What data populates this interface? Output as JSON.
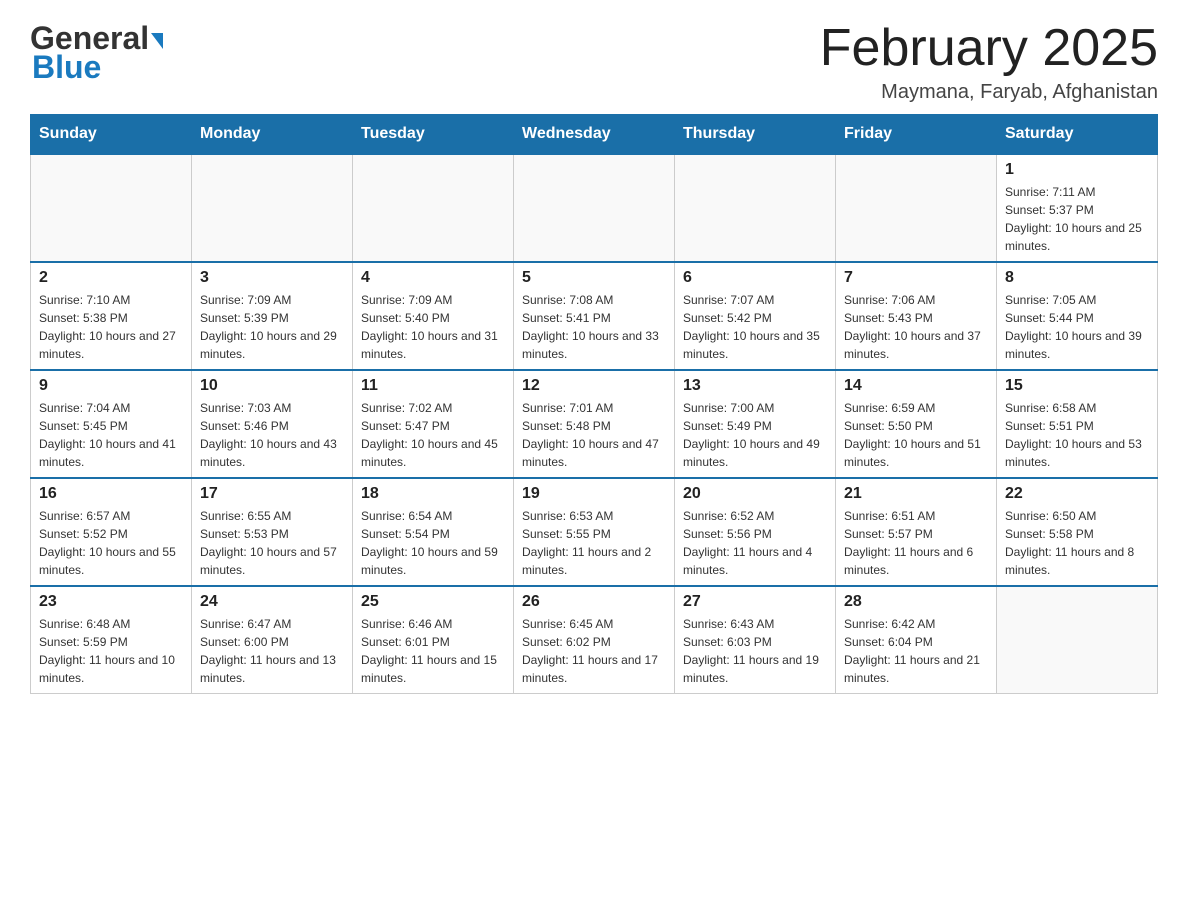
{
  "header": {
    "logo_main": "General",
    "logo_blue": "Blue",
    "month_title": "February 2025",
    "location": "Maymana, Faryab, Afghanistan"
  },
  "weekdays": [
    "Sunday",
    "Monday",
    "Tuesday",
    "Wednesday",
    "Thursday",
    "Friday",
    "Saturday"
  ],
  "weeks": [
    {
      "days": [
        {
          "num": "",
          "info": ""
        },
        {
          "num": "",
          "info": ""
        },
        {
          "num": "",
          "info": ""
        },
        {
          "num": "",
          "info": ""
        },
        {
          "num": "",
          "info": ""
        },
        {
          "num": "",
          "info": ""
        },
        {
          "num": "1",
          "info": "Sunrise: 7:11 AM\nSunset: 5:37 PM\nDaylight: 10 hours and 25 minutes."
        }
      ]
    },
    {
      "days": [
        {
          "num": "2",
          "info": "Sunrise: 7:10 AM\nSunset: 5:38 PM\nDaylight: 10 hours and 27 minutes."
        },
        {
          "num": "3",
          "info": "Sunrise: 7:09 AM\nSunset: 5:39 PM\nDaylight: 10 hours and 29 minutes."
        },
        {
          "num": "4",
          "info": "Sunrise: 7:09 AM\nSunset: 5:40 PM\nDaylight: 10 hours and 31 minutes."
        },
        {
          "num": "5",
          "info": "Sunrise: 7:08 AM\nSunset: 5:41 PM\nDaylight: 10 hours and 33 minutes."
        },
        {
          "num": "6",
          "info": "Sunrise: 7:07 AM\nSunset: 5:42 PM\nDaylight: 10 hours and 35 minutes."
        },
        {
          "num": "7",
          "info": "Sunrise: 7:06 AM\nSunset: 5:43 PM\nDaylight: 10 hours and 37 minutes."
        },
        {
          "num": "8",
          "info": "Sunrise: 7:05 AM\nSunset: 5:44 PM\nDaylight: 10 hours and 39 minutes."
        }
      ]
    },
    {
      "days": [
        {
          "num": "9",
          "info": "Sunrise: 7:04 AM\nSunset: 5:45 PM\nDaylight: 10 hours and 41 minutes."
        },
        {
          "num": "10",
          "info": "Sunrise: 7:03 AM\nSunset: 5:46 PM\nDaylight: 10 hours and 43 minutes."
        },
        {
          "num": "11",
          "info": "Sunrise: 7:02 AM\nSunset: 5:47 PM\nDaylight: 10 hours and 45 minutes."
        },
        {
          "num": "12",
          "info": "Sunrise: 7:01 AM\nSunset: 5:48 PM\nDaylight: 10 hours and 47 minutes."
        },
        {
          "num": "13",
          "info": "Sunrise: 7:00 AM\nSunset: 5:49 PM\nDaylight: 10 hours and 49 minutes."
        },
        {
          "num": "14",
          "info": "Sunrise: 6:59 AM\nSunset: 5:50 PM\nDaylight: 10 hours and 51 minutes."
        },
        {
          "num": "15",
          "info": "Sunrise: 6:58 AM\nSunset: 5:51 PM\nDaylight: 10 hours and 53 minutes."
        }
      ]
    },
    {
      "days": [
        {
          "num": "16",
          "info": "Sunrise: 6:57 AM\nSunset: 5:52 PM\nDaylight: 10 hours and 55 minutes."
        },
        {
          "num": "17",
          "info": "Sunrise: 6:55 AM\nSunset: 5:53 PM\nDaylight: 10 hours and 57 minutes."
        },
        {
          "num": "18",
          "info": "Sunrise: 6:54 AM\nSunset: 5:54 PM\nDaylight: 10 hours and 59 minutes."
        },
        {
          "num": "19",
          "info": "Sunrise: 6:53 AM\nSunset: 5:55 PM\nDaylight: 11 hours and 2 minutes."
        },
        {
          "num": "20",
          "info": "Sunrise: 6:52 AM\nSunset: 5:56 PM\nDaylight: 11 hours and 4 minutes."
        },
        {
          "num": "21",
          "info": "Sunrise: 6:51 AM\nSunset: 5:57 PM\nDaylight: 11 hours and 6 minutes."
        },
        {
          "num": "22",
          "info": "Sunrise: 6:50 AM\nSunset: 5:58 PM\nDaylight: 11 hours and 8 minutes."
        }
      ]
    },
    {
      "days": [
        {
          "num": "23",
          "info": "Sunrise: 6:48 AM\nSunset: 5:59 PM\nDaylight: 11 hours and 10 minutes."
        },
        {
          "num": "24",
          "info": "Sunrise: 6:47 AM\nSunset: 6:00 PM\nDaylight: 11 hours and 13 minutes."
        },
        {
          "num": "25",
          "info": "Sunrise: 6:46 AM\nSunset: 6:01 PM\nDaylight: 11 hours and 15 minutes."
        },
        {
          "num": "26",
          "info": "Sunrise: 6:45 AM\nSunset: 6:02 PM\nDaylight: 11 hours and 17 minutes."
        },
        {
          "num": "27",
          "info": "Sunrise: 6:43 AM\nSunset: 6:03 PM\nDaylight: 11 hours and 19 minutes."
        },
        {
          "num": "28",
          "info": "Sunrise: 6:42 AM\nSunset: 6:04 PM\nDaylight: 11 hours and 21 minutes."
        },
        {
          "num": "",
          "info": ""
        }
      ]
    }
  ]
}
